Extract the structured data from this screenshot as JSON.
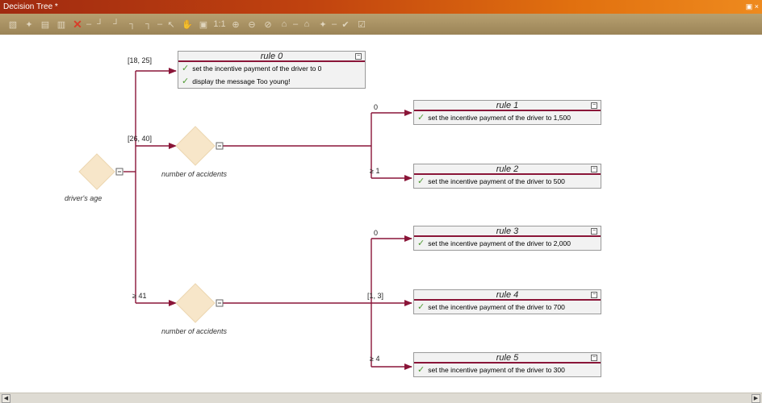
{
  "window": {
    "title": "Decision Tree *",
    "controls": "▣ ×"
  },
  "toolbar": {
    "icons": [
      "▧",
      "✦",
      "▤",
      "▥",
      "✕",
      "–",
      "┘",
      "┘",
      "┐",
      "┐",
      "–",
      "↖",
      "✋",
      "▣",
      "1:1",
      "⊕",
      "⊖",
      "⊘",
      "⌂",
      "–",
      "⌂",
      "✦",
      "–",
      "✔",
      "☑"
    ]
  },
  "tree": {
    "root_label": "driver's age",
    "accidents_label_1": "number of accidents",
    "accidents_label_2": "number of accidents",
    "edges": {
      "age_18_25": "[18, 25]",
      "age_26_40": "[26, 40]",
      "age_41": "≥ 41",
      "acc1_0": "0",
      "acc1_ge1": "≥ 1",
      "acc2_0": "0",
      "acc2_1_3": "[1, 3]",
      "acc2_ge4": "≥ 4"
    }
  },
  "rules": [
    {
      "title": "rule 0",
      "actions": [
        "set the incentive payment of the driver to 0",
        "display the message Too young!"
      ]
    },
    {
      "title": "rule 1",
      "actions": [
        "set the incentive payment of the driver to 1,500"
      ]
    },
    {
      "title": "rule 2",
      "actions": [
        "set the incentive payment of the driver to 500"
      ]
    },
    {
      "title": "rule 3",
      "actions": [
        "set the incentive payment of the driver to 2,000"
      ]
    },
    {
      "title": "rule 4",
      "actions": [
        "set the incentive payment of the driver to 700"
      ]
    },
    {
      "title": "rule 5",
      "actions": [
        "set the incentive payment of the driver to 300"
      ]
    }
  ],
  "colors": {
    "wire": "#8a1538",
    "diamond": "#f7e6c9",
    "check": "#4f9a32"
  }
}
